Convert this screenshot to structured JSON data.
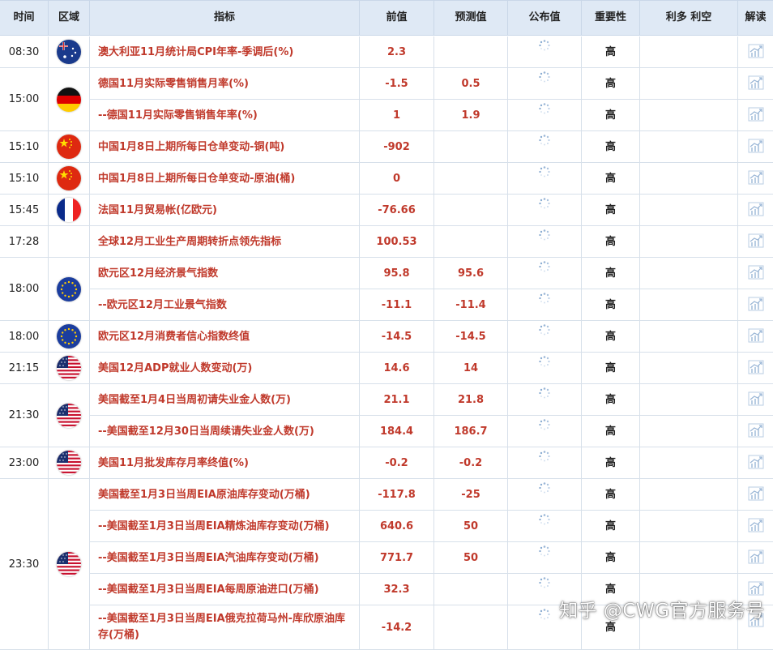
{
  "headers": {
    "time": "时间",
    "region": "区域",
    "indicator": "指标",
    "previous": "前值",
    "forecast": "预测值",
    "actual": "公布值",
    "importance": "重要性",
    "impact": "利多 利空",
    "analysis": "解读"
  },
  "groups": [
    {
      "time": "08:30",
      "flag": "australia-flag",
      "rows": [
        0
      ]
    },
    {
      "time": "15:00",
      "flag": "germany-flag",
      "rows": [
        1,
        2
      ]
    },
    {
      "time": "15:10",
      "flag": "china-flag",
      "rows": [
        3
      ]
    },
    {
      "time": "15:10",
      "flag": "china-flag",
      "rows": [
        4
      ]
    },
    {
      "time": "15:45",
      "flag": "france-flag",
      "rows": [
        5
      ]
    },
    {
      "time": "17:28",
      "flag": "",
      "rows": [
        6
      ]
    },
    {
      "time": "18:00",
      "flag": "eu-flag",
      "rows": [
        7,
        8
      ]
    },
    {
      "time": "18:00",
      "flag": "eu-flag",
      "rows": [
        9
      ]
    },
    {
      "time": "21:15",
      "flag": "usa-flag",
      "rows": [
        10
      ]
    },
    {
      "time": "21:30",
      "flag": "usa-flag",
      "rows": [
        11,
        12
      ]
    },
    {
      "time": "23:00",
      "flag": "usa-flag",
      "rows": [
        13
      ]
    },
    {
      "time": "23:30",
      "flag": "usa-flag",
      "rows": [
        14,
        15,
        16,
        17,
        18
      ]
    }
  ],
  "rows": [
    {
      "name": "澳大利亚11月统计局CPI年率-季调后(%)",
      "previous": "2.3",
      "forecast": "",
      "importance": "高"
    },
    {
      "name": "德国11月实际零售销售月率(%)",
      "previous": "-1.5",
      "forecast": "0.5",
      "importance": "高"
    },
    {
      "name": "--德国11月实际零售销售年率(%)",
      "previous": "1",
      "forecast": "1.9",
      "importance": "高"
    },
    {
      "name": "中国1月8日上期所每日仓单变动-铜(吨)",
      "previous": "-902",
      "forecast": "",
      "importance": "高"
    },
    {
      "name": "中国1月8日上期所每日仓单变动-原油(桶)",
      "previous": "0",
      "forecast": "",
      "importance": "高"
    },
    {
      "name": "法国11月贸易帐(亿欧元)",
      "previous": "-76.66",
      "forecast": "",
      "importance": "高"
    },
    {
      "name": "全球12月工业生产周期转折点领先指标",
      "previous": "100.53",
      "forecast": "",
      "importance": "高"
    },
    {
      "name": "欧元区12月经济景气指数",
      "previous": "95.8",
      "forecast": "95.6",
      "importance": "高"
    },
    {
      "name": "--欧元区12月工业景气指数",
      "previous": "-11.1",
      "forecast": "-11.4",
      "importance": "高"
    },
    {
      "name": "欧元区12月消费者信心指数终值",
      "previous": "-14.5",
      "forecast": "-14.5",
      "importance": "高"
    },
    {
      "name": "美国12月ADP就业人数变动(万)",
      "previous": "14.6",
      "forecast": "14",
      "importance": "高"
    },
    {
      "name": "美国截至1月4日当周初请失业金人数(万)",
      "previous": "21.1",
      "forecast": "21.8",
      "importance": "高"
    },
    {
      "name": "--美国截至12月30日当周续请失业金人数(万)",
      "previous": "184.4",
      "forecast": "186.7",
      "importance": "高"
    },
    {
      "name": "美国11月批发库存月率终值(%)",
      "previous": "-0.2",
      "forecast": "-0.2",
      "importance": "高"
    },
    {
      "name": "美国截至1月3日当周EIA原油库存变动(万桶)",
      "previous": "-117.8",
      "forecast": "-25",
      "importance": "高"
    },
    {
      "name": "--美国截至1月3日当周EIA精炼油库存变动(万桶)",
      "previous": "640.6",
      "forecast": "50",
      "importance": "高"
    },
    {
      "name": "--美国截至1月3日当周EIA汽油库存变动(万桶)",
      "previous": "771.7",
      "forecast": "50",
      "importance": "高"
    },
    {
      "name": "--美国截至1月3日当周EIA每周原油进口(万桶)",
      "previous": "32.3",
      "forecast": "",
      "importance": "高"
    },
    {
      "name": "--美国截至1月3日当周EIA俄克拉荷马州-库欣原油库存(万桶)",
      "previous": "-14.2",
      "forecast": "",
      "importance": "高"
    }
  ],
  "watermark": "知乎 @CWG官方服务号",
  "colors": {
    "header_bg": "#dfe9f5",
    "value_red": "#c0392b",
    "border": "#d7e0ea"
  }
}
